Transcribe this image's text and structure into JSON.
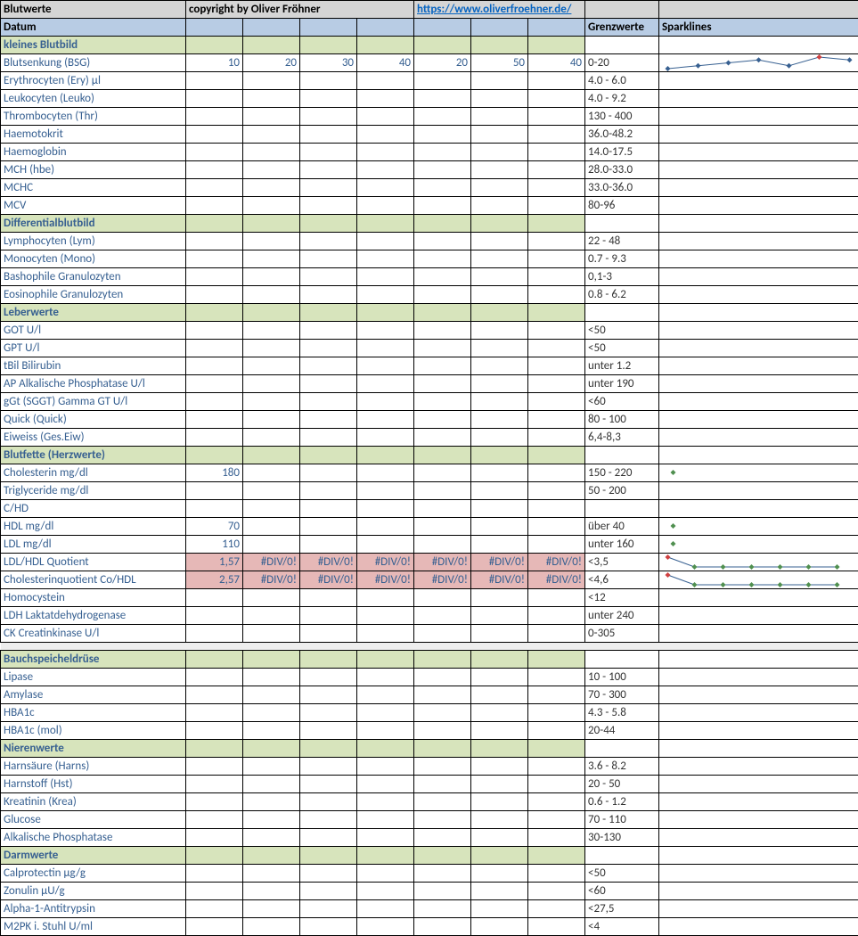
{
  "header": {
    "title": "Blutwerte",
    "copyright": "copyright by Oliver Fröhner",
    "url_text": "https://www.oliverfroehner.de/",
    "datum": "Datum",
    "grenzwerte": "Grenzwerte",
    "sparklines": "Sparklines"
  },
  "sections": {
    "kleines_blutbild": "kleines Blutbild",
    "diff": "Differentialblutbild",
    "leber": "Leberwerte",
    "blutfette": "Blutfette (Herzwerte)",
    "bauch": "Bauchspeicheldrüse",
    "nieren": "Nierenwerte",
    "darm": "Darmwerte"
  },
  "rows": {
    "bsg": {
      "label": "Blutsenkung (BSG)",
      "v": [
        "10",
        "20",
        "30",
        "40",
        "20",
        "50",
        "40"
      ],
      "lim": "0-20"
    },
    "ery": {
      "label": "Erythrocyten (Ery) µl",
      "v": [
        "",
        "",
        "",
        "",
        "",
        "",
        ""
      ],
      "lim": "4.0 - 6.0"
    },
    "leuko": {
      "label": "Leukocyten (Leuko)",
      "v": [
        "",
        "",
        "",
        "",
        "",
        "",
        ""
      ],
      "lim": "4.0 - 9.2"
    },
    "thr": {
      "label": "Thrombocyten (Thr)",
      "v": [
        "",
        "",
        "",
        "",
        "",
        "",
        ""
      ],
      "lim": "130 - 400"
    },
    "hkt": {
      "label": "Haemotokrit",
      "v": [
        "",
        "",
        "",
        "",
        "",
        "",
        ""
      ],
      "lim": "36.0-48.2"
    },
    "hb": {
      "label": "Haemoglobin",
      "v": [
        "",
        "",
        "",
        "",
        "",
        "",
        ""
      ],
      "lim": "14.0-17.5"
    },
    "mch": {
      "label": "MCH (hbe)",
      "v": [
        "",
        "",
        "",
        "",
        "",
        "",
        ""
      ],
      "lim": "28.0-33.0"
    },
    "mchc": {
      "label": "MCHC",
      "v": [
        "",
        "",
        "",
        "",
        "",
        "",
        ""
      ],
      "lim": "33.0-36.0"
    },
    "mcv": {
      "label": "MCV",
      "v": [
        "",
        "",
        "",
        "",
        "",
        "",
        ""
      ],
      "lim": "80-96"
    },
    "lym": {
      "label": "Lymphocyten (Lym)",
      "v": [
        "",
        "",
        "",
        "",
        "",
        "",
        ""
      ],
      "lim": "22 - 48"
    },
    "mono": {
      "label": "Monocyten (Mono)",
      "v": [
        "",
        "",
        "",
        "",
        "",
        "",
        ""
      ],
      "lim": "0.7 - 9.3"
    },
    "baso": {
      "label": "Bashophile Granulozyten",
      "v": [
        "",
        "",
        "",
        "",
        "",
        "",
        ""
      ],
      "lim": "0,1-3"
    },
    "eos": {
      "label": "Eosinophile Granulozyten",
      "v": [
        "",
        "",
        "",
        "",
        "",
        "",
        ""
      ],
      "lim": "0.8 - 6.2"
    },
    "got": {
      "label": "GOT U/l",
      "v": [
        "",
        "",
        "",
        "",
        "",
        "",
        ""
      ],
      "lim": "<50"
    },
    "gpt": {
      "label": "GPT U/l",
      "v": [
        "",
        "",
        "",
        "",
        "",
        "",
        ""
      ],
      "lim": "<50"
    },
    "tbil": {
      "label": "tBil Bilirubin",
      "v": [
        "",
        "",
        "",
        "",
        "",
        "",
        ""
      ],
      "lim": "unter 1.2"
    },
    "ap": {
      "label": "AP Alkalische Phosphatase U/l",
      "v": [
        "",
        "",
        "",
        "",
        "",
        "",
        ""
      ],
      "lim": " unter 190"
    },
    "ggt": {
      "label": "gGt (SGGT) Gamma GT U/l",
      "v": [
        "",
        "",
        "",
        "",
        "",
        "",
        ""
      ],
      "lim": "<60"
    },
    "quick": {
      "label": "Quick (Quick)",
      "v": [
        "",
        "",
        "",
        "",
        "",
        "",
        ""
      ],
      "lim": " 80 - 100"
    },
    "eiw": {
      "label": "Eiweiss (Ges.Eiw)",
      "v": [
        "",
        "",
        "",
        "",
        "",
        "",
        ""
      ],
      "lim": "6,4-8,3"
    },
    "chol": {
      "label": "Cholesterin mg/dl",
      "v": [
        "180",
        "",
        "",
        "",
        "",
        "",
        ""
      ],
      "lim": "150 - 220"
    },
    "trig": {
      "label": "Triglyceride mg/dl",
      "v": [
        "",
        "",
        "",
        "",
        "",
        "",
        ""
      ],
      "lim": "50 - 200"
    },
    "chd": {
      "label": "C/HD",
      "v": [
        "",
        "",
        "",
        "",
        "",
        "",
        ""
      ],
      "lim": ""
    },
    "hdl": {
      "label": "HDL  mg/dl",
      "v": [
        "70",
        "",
        "",
        "",
        "",
        "",
        ""
      ],
      "lim": "über 40"
    },
    "ldl": {
      "label": "LDL  mg/dl",
      "v": [
        "110",
        "",
        "",
        "",
        "",
        "",
        ""
      ],
      "lim": "unter 160"
    },
    "ldlhdl": {
      "label": "LDL/HDL Quotient",
      "v": [
        "1,57",
        "#DIV/0!",
        "#DIV/0!",
        "#DIV/0!",
        "#DIV/0!",
        "#DIV/0!",
        "#DIV/0!"
      ],
      "lim": "<3,5"
    },
    "coq": {
      "label": "Cholesterinquotient Co/HDL",
      "v": [
        "2,57",
        "#DIV/0!",
        "#DIV/0!",
        "#DIV/0!",
        "#DIV/0!",
        "#DIV/0!",
        "#DIV/0!"
      ],
      "lim": "<4,6"
    },
    "homo": {
      "label": "Homocystein",
      "v": [
        "",
        "",
        "",
        "",
        "",
        "",
        ""
      ],
      "lim": "<12"
    },
    "ldh": {
      "label": "LDH Laktatdehydrogenase",
      "v": [
        "",
        "",
        "",
        "",
        "",
        "",
        ""
      ],
      "lim": "unter 240"
    },
    "ck": {
      "label": "CK Creatinkinase U/l",
      "v": [
        "",
        "",
        "",
        "",
        "",
        "",
        ""
      ],
      "lim": "0-305"
    },
    "lip": {
      "label": "Lipase",
      "v": [
        "",
        "",
        "",
        "",
        "",
        "",
        ""
      ],
      "lim": " 10 - 100"
    },
    "amy": {
      "label": "Amylase",
      "v": [
        "",
        "",
        "",
        "",
        "",
        "",
        ""
      ],
      "lim": " 70 - 300"
    },
    "hba1c": {
      "label": "HBA1c",
      "v": [
        "",
        "",
        "",
        "",
        "",
        "",
        ""
      ],
      "lim": "4.3 - 5.8"
    },
    "hba1cm": {
      "label": "HBA1c (mol)",
      "v": [
        "",
        "",
        "",
        "",
        "",
        "",
        ""
      ],
      "lim": "20-44"
    },
    "harns": {
      "label": "Harnsäure (Harns)",
      "v": [
        "",
        "",
        "",
        "",
        "",
        "",
        ""
      ],
      "lim": "3.6 - 8.2"
    },
    "hst": {
      "label": "Harnstoff (Hst)",
      "v": [
        "",
        "",
        "",
        "",
        "",
        "",
        ""
      ],
      "lim": "20 - 50"
    },
    "krea": {
      "label": "Kreatinin  (Krea)",
      "v": [
        "",
        "",
        "",
        "",
        "",
        "",
        ""
      ],
      "lim": "0.6 - 1.2"
    },
    "gluc": {
      "label": "Glucose",
      "v": [
        "",
        "",
        "",
        "",
        "",
        "",
        ""
      ],
      "lim": "70 - 110"
    },
    "alkp": {
      "label": "Alkalische Phosphatase",
      "v": [
        "",
        "",
        "",
        "",
        "",
        "",
        ""
      ],
      "lim": "30-130"
    },
    "calp": {
      "label": "Calprotectin µg/g",
      "v": [
        "",
        "",
        "",
        "",
        "",
        "",
        ""
      ],
      "lim": "<50"
    },
    "zon": {
      "label": "Zonulin µU/g",
      "v": [
        "",
        "",
        "",
        "",
        "",
        "",
        ""
      ],
      "lim": "<60"
    },
    "a1at": {
      "label": "Alpha-1-Antitrypsin",
      "v": [
        "",
        "",
        "",
        "",
        "",
        "",
        ""
      ],
      "lim": "<27,5"
    },
    "m2pk": {
      "label": "M2PK i. Stuhl U/ml",
      "v": [
        "",
        "",
        "",
        "",
        "",
        "",
        ""
      ],
      "lim": "<4"
    }
  },
  "chart_data": [
    {
      "type": "line",
      "name": "bsg-sparkline",
      "x": [
        1,
        2,
        3,
        4,
        5,
        6,
        7
      ],
      "values": [
        10,
        20,
        30,
        40,
        20,
        50,
        40
      ],
      "outlier_index": 5,
      "color": "#376091"
    },
    {
      "type": "line",
      "name": "chol-sparkline",
      "x": [
        1
      ],
      "values": [
        180
      ],
      "color": "#4f8f4f"
    },
    {
      "type": "line",
      "name": "hdl-sparkline",
      "x": [
        1
      ],
      "values": [
        70
      ],
      "color": "#4f8f4f"
    },
    {
      "type": "line",
      "name": "ldl-sparkline",
      "x": [
        1
      ],
      "values": [
        110
      ],
      "color": "#4f8f4f"
    },
    {
      "type": "line",
      "name": "ldlhdl-sparkline",
      "x": [
        1,
        2,
        3,
        4,
        5,
        6,
        7
      ],
      "values": [
        1.57,
        0,
        0,
        0,
        0,
        0,
        0
      ],
      "first_outlier": true,
      "color": "#376091",
      "marker": "#4f8f4f"
    },
    {
      "type": "line",
      "name": "coq-sparkline",
      "x": [
        1,
        2,
        3,
        4,
        5,
        6,
        7
      ],
      "values": [
        2.57,
        0,
        0,
        0,
        0,
        0,
        0
      ],
      "first_outlier": true,
      "color": "#376091",
      "marker": "#4f8f4f"
    }
  ]
}
